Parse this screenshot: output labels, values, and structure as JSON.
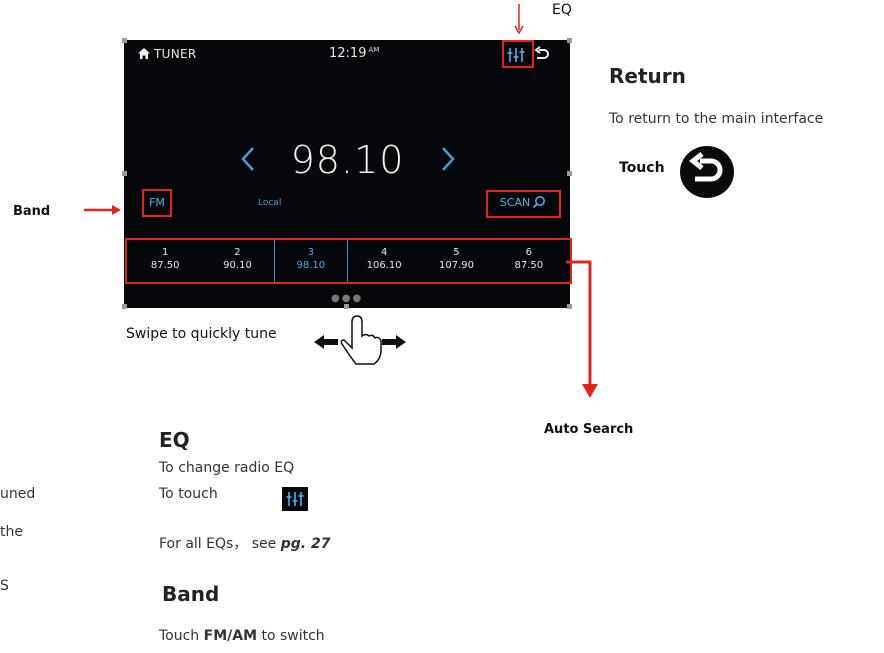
{
  "screen": {
    "tuner_label": "TUNER",
    "time": "12:19",
    "ampm": "AM",
    "frequency": "98.10",
    "band": "FM",
    "local_label": "Local",
    "scan_label": "SCAN",
    "presets": [
      {
        "num": "1",
        "freq": "87.50"
      },
      {
        "num": "2",
        "freq": "90.10"
      },
      {
        "num": "3",
        "freq": "98.10"
      },
      {
        "num": "4",
        "freq": "106.10"
      },
      {
        "num": "5",
        "freq": "107.90"
      },
      {
        "num": "6",
        "freq": "87.50"
      }
    ],
    "active_preset": 3,
    "accent_color": "#4fb3ec",
    "highlight_color": "#e3241c"
  },
  "annotations": {
    "eq_top": "EQ",
    "band_left": "Band",
    "swipe": "Swipe to quickly tune",
    "auto_search": "Auto Search"
  },
  "return_section": {
    "heading": "Return",
    "text": "To return to the main interface",
    "touch": "Touch"
  },
  "eq_section": {
    "heading": "EQ",
    "line1": "To change radio EQ",
    "line2": "To touch",
    "line3_prefix": "For all EQs， see ",
    "line3_ref": "pg. 27"
  },
  "band_section": {
    "heading": "Band",
    "prefix": "Touch ",
    "bold": "FM/AM",
    "suffix": " to switch"
  },
  "cut_off_text": [
    "uned",
    "the",
    "S"
  ]
}
